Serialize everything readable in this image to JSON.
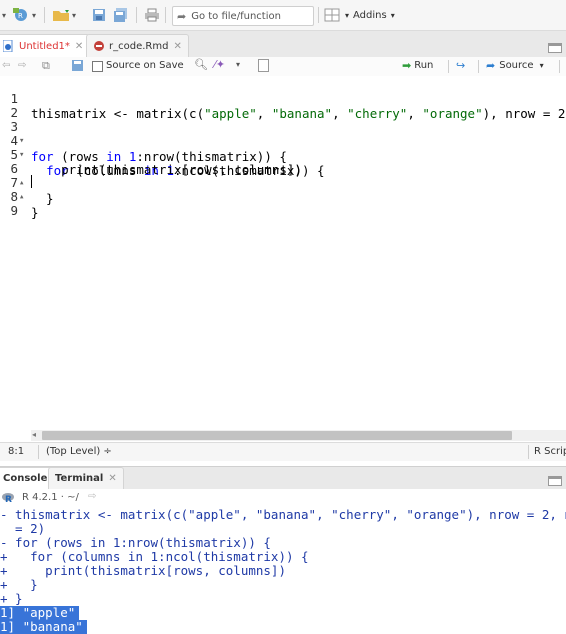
{
  "toolbar": {
    "goto_placeholder": "Go to file/function",
    "addins_label": "Addins"
  },
  "editor_tabs": [
    {
      "label": "Untitled1*",
      "active": true
    },
    {
      "label": "r_code.Rmd",
      "active": false
    }
  ],
  "editor_toolbar": {
    "source_on_save": "Source on Save",
    "run_label": "Run",
    "source_label": "Source"
  },
  "editor": {
    "lines": [
      {
        "num": "1",
        "fold": "",
        "code": "thismatrix <- matrix(c(\"apple\", \"banana\", \"cherry\", \"orange\"), nrow = 2"
      },
      {
        "num": "2",
        "fold": "",
        "code": ""
      },
      {
        "num": "3",
        "fold": "▾",
        "code": "for (rows in 1:nrow(thismatrix)) {"
      },
      {
        "num": "4",
        "fold": "▾",
        "code": "  for (columns in 1:ncol(thismatrix)) {"
      },
      {
        "num": "5",
        "fold": "",
        "code": "    print(thismatrix[rows, columns])"
      },
      {
        "num": "6",
        "fold": "▴",
        "code": "  }"
      },
      {
        "num": "7",
        "fold": "▴",
        "code": "}"
      },
      {
        "num": "8",
        "fold": "",
        "code": ""
      },
      {
        "num": "9",
        "fold": "",
        "code": ""
      }
    ]
  },
  "status": {
    "position": "8:1",
    "scope": "(Top Level) ÷",
    "file_type": "R Scrip"
  },
  "console_tabs": [
    {
      "label": "Console",
      "active": true
    },
    {
      "label": "Terminal",
      "active": false
    }
  ],
  "console_info": "R 4.2.1 · ~/",
  "console": {
    "lines": [
      "- thismatrix <- matrix(c(\"apple\", \"banana\", \"cherry\", \"orange\"), nrow = 2, n",
      "  = 2)",
      "- for (rows in 1:nrow(thismatrix)) {",
      "+   for (columns in 1:ncol(thismatrix)) {",
      "+     print(thismatrix[rows, columns])",
      "+   }",
      "+ }"
    ],
    "output": [
      "1] \"apple\"",
      "1] \"banana\""
    ]
  }
}
